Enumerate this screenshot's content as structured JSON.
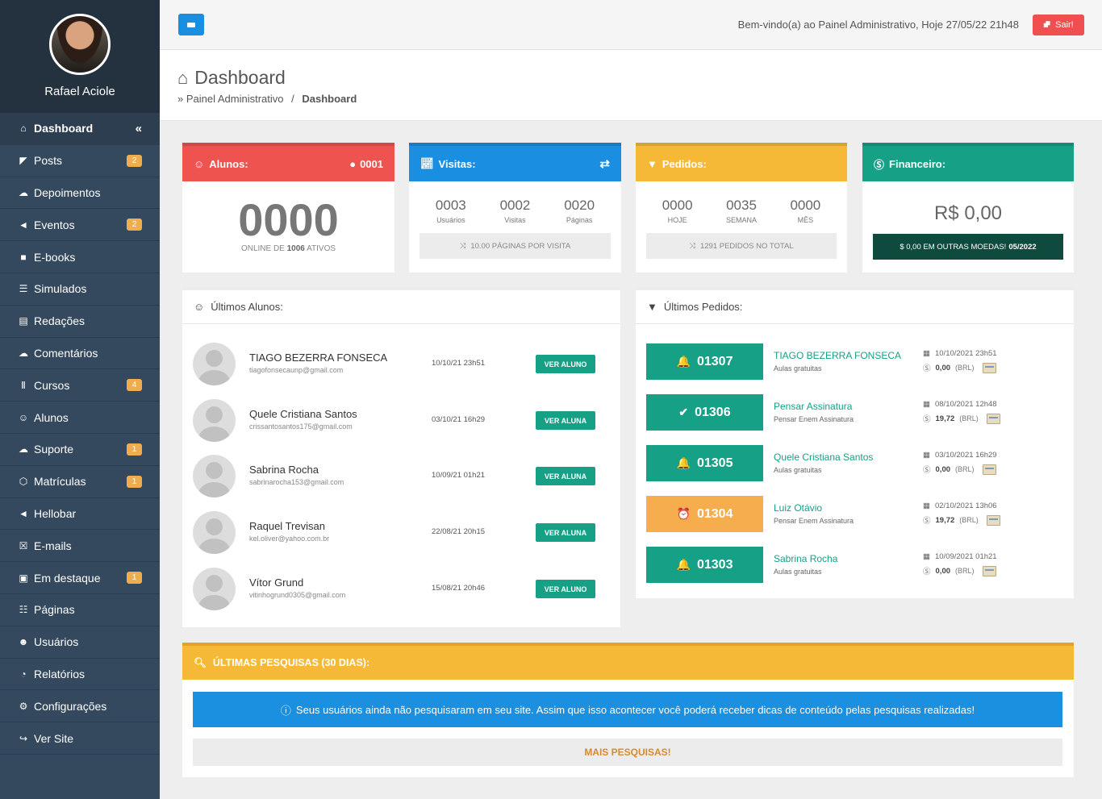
{
  "user": {
    "name": "Rafael Aciole"
  },
  "sidebar": {
    "items": [
      {
        "label": "Dashboard",
        "icon": "home-icon",
        "badge": null,
        "active": true
      },
      {
        "label": "Posts",
        "icon": "rss-icon",
        "badge": "2"
      },
      {
        "label": "Depoimentos",
        "icon": "comment-icon",
        "badge": null
      },
      {
        "label": "Eventos",
        "icon": "bullhorn-icon",
        "badge": "2"
      },
      {
        "label": "E-books",
        "icon": "book-icon",
        "badge": null
      },
      {
        "label": "Simulados",
        "icon": "list-icon",
        "badge": null
      },
      {
        "label": "Redações",
        "icon": "file-icon",
        "badge": null
      },
      {
        "label": "Comentários",
        "icon": "comments-icon",
        "badge": null
      },
      {
        "label": "Cursos",
        "icon": "library-icon",
        "badge": "4"
      },
      {
        "label": "Alunos",
        "icon": "user-icon",
        "badge": null
      },
      {
        "label": "Suporte",
        "icon": "support-icon",
        "badge": "1"
      },
      {
        "label": "Matrículas",
        "icon": "cube-icon",
        "badge": "1"
      },
      {
        "label": "Hellobar",
        "icon": "megaphone-icon",
        "badge": null
      },
      {
        "label": "E-mails",
        "icon": "mail-icon",
        "badge": null
      },
      {
        "label": "Em destaque",
        "icon": "image-icon",
        "badge": "1"
      },
      {
        "label": "Páginas",
        "icon": "pages-icon",
        "badge": null
      },
      {
        "label": "Usuários",
        "icon": "users-icon",
        "badge": null
      },
      {
        "label": "Relatórios",
        "icon": "pie-chart-icon",
        "badge": null
      },
      {
        "label": "Configurações",
        "icon": "cogs-icon",
        "badge": null
      },
      {
        "label": "Ver Site",
        "icon": "share-icon",
        "badge": null
      }
    ],
    "collapse": "«"
  },
  "topbar": {
    "welcome": "Bem-vindo(a) ao Painel Administrativo, Hoje 27/05/22 21h48",
    "logout": "Sair!"
  },
  "header": {
    "title": "Dashboard",
    "breadcrumb_prefix": "» Painel Administrativo",
    "breadcrumb_sep": "/",
    "breadcrumb_current": "Dashboard"
  },
  "stats": {
    "alunos": {
      "title": "Alunos:",
      "online_count": "0001",
      "big": "0000",
      "sub_prefix": "ONLINE DE",
      "sub_num": "1006",
      "sub_suffix": "ATIVOS",
      "color": "#ef5350"
    },
    "visitas": {
      "title": "Visitas:",
      "color": "#1a8ee1",
      "values": [
        {
          "n": "0003",
          "l": "Usuários"
        },
        {
          "n": "0002",
          "l": "Visitas"
        },
        {
          "n": "0020",
          "l": "Páginas"
        }
      ],
      "bar": "10.00 PÁGINAS POR VISITA"
    },
    "pedidos": {
      "title": "Pedidos:",
      "color": "#f5b937",
      "values": [
        {
          "n": "0000",
          "l": "HOJE"
        },
        {
          "n": "0035",
          "l": "SEMANA"
        },
        {
          "n": "0000",
          "l": "MÊS"
        }
      ],
      "bar": "1291 PEDIDOS NO TOTAL"
    },
    "financeiro": {
      "title": "Financeiro:",
      "color": "#16a085",
      "value": "R$ 0,00",
      "bar_text": "$ 0,00 EM OUTRAS MOEDAS!",
      "bar_period": "05/2022"
    }
  },
  "ultimos_alunos": {
    "title": "Últimos Alunos:",
    "rows": [
      {
        "name": "TIAGO BEZERRA FONSECA",
        "email": "tiagofonsecaunp@gmail.com",
        "date": "10/10/21 23h51",
        "button": "VER ALUNO"
      },
      {
        "name": "Quele Cristiana Santos",
        "email": "crissantosantos175@gmail.com",
        "date": "03/10/21 16h29",
        "button": "VER ALUNA"
      },
      {
        "name": "Sabrina Rocha",
        "email": "sabrinarocha153@gmail.com",
        "date": "10/09/21 01h21",
        "button": "VER ALUNA"
      },
      {
        "name": "Raquel Trevisan",
        "email": "kel.oliver@yahoo.com.br",
        "date": "22/08/21 20h15",
        "button": "VER ALUNA"
      },
      {
        "name": "Vítor Grund",
        "email": "vitinhogrund0305@gmail.com",
        "date": "15/08/21 20h46",
        "button": "VER ALUNO"
      }
    ]
  },
  "ultimos_pedidos": {
    "title": "Últimos Pedidos:",
    "rows": [
      {
        "num": "01307",
        "icon": "bell-icon",
        "glyph": "🔔",
        "color": "#16a085",
        "name": "TIAGO BEZERRA FONSECA",
        "desc": "Aulas gratuitas",
        "date": "10/10/2021 23h51",
        "value": "0,00",
        "currency": "(BRL)"
      },
      {
        "num": "01306",
        "icon": "check-icon",
        "glyph": "✔",
        "color": "#16a085",
        "name": "Pensar Assinatura",
        "desc": "Pensar Enem Assinatura",
        "date": "08/10/2021 12h48",
        "value": "19,72",
        "currency": "(BRL)"
      },
      {
        "num": "01305",
        "icon": "bell-icon",
        "glyph": "🔔",
        "color": "#16a085",
        "name": "Quele Cristiana Santos",
        "desc": "Aulas gratuitas",
        "date": "03/10/2021 16h29",
        "value": "0,00",
        "currency": "(BRL)"
      },
      {
        "num": "01304",
        "icon": "alarm-icon",
        "glyph": "⏰",
        "color": "#f5ad4e",
        "name": "Luiz Otávio",
        "desc": "Pensar Enem Assinatura",
        "date": "02/10/2021 13h06",
        "value": "19,72",
        "currency": "(BRL)"
      },
      {
        "num": "01303",
        "icon": "bell-icon",
        "glyph": "🔔",
        "color": "#16a085",
        "name": "Sabrina Rocha",
        "desc": "Aulas gratuitas",
        "date": "10/09/2021 01h21",
        "value": "0,00",
        "currency": "(BRL)"
      }
    ]
  },
  "pesquisas": {
    "title": "ÚLTIMAS PESQUISAS (30 DIAS):",
    "info": "Seus usuários ainda não pesquisaram em seu site. Assim que isso acontecer você poderá receber dicas de conteúdo pelas pesquisas realizadas!",
    "button": "MAIS PESQUISAS!"
  }
}
